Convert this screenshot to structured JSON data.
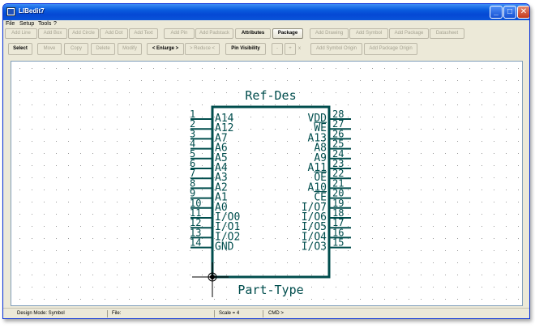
{
  "window": {
    "title": "LIBedit7",
    "minimize": "_",
    "maximize": "□",
    "close": "✕"
  },
  "menu": [
    "File",
    "Setup",
    "Tools",
    "?"
  ],
  "toolbar1": [
    {
      "label": "Add Line",
      "active": false
    },
    {
      "label": "Add Box",
      "active": false
    },
    {
      "label": "Add Circle",
      "active": false
    },
    {
      "label": "Add Dot",
      "active": false
    },
    {
      "label": "Add Text",
      "active": false
    },
    {
      "label": "Add Pin",
      "active": false
    },
    {
      "label": "Add Padstack",
      "active": false
    },
    {
      "label": "Attributes",
      "active": true
    },
    {
      "label": "Package",
      "active": true
    },
    {
      "label": "Add Drawing",
      "active": false
    },
    {
      "label": "Add Symbol",
      "active": false
    },
    {
      "label": "Add Package",
      "active": false
    },
    {
      "label": "Datasheet",
      "active": false
    }
  ],
  "toolbar2": [
    {
      "label": "Select",
      "active": true
    },
    {
      "label": "Move",
      "active": false
    },
    {
      "label": "Copy",
      "active": false
    },
    {
      "label": "Delete",
      "active": false
    },
    {
      "label": "Modify",
      "active": false
    },
    {
      "label": "< Enlarge >",
      "active": true
    },
    {
      "label": "> Reduce <",
      "active": false
    },
    {
      "label": "Pin Visibility",
      "active": true
    },
    {
      "label": "-",
      "active": false
    },
    {
      "label": "+",
      "active": false
    },
    {
      "label": "Add Symbol Origin",
      "active": false
    },
    {
      "label": "Add Package Origin",
      "active": false
    }
  ],
  "toolbar2_x_label": "x",
  "symbol": {
    "ref_des": "Ref-Des",
    "part_type": "Part-Type",
    "color": "#004d4d",
    "left_pins": [
      {
        "num": "1",
        "name": "A14"
      },
      {
        "num": "2",
        "name": "A12"
      },
      {
        "num": "3",
        "name": "A7"
      },
      {
        "num": "4",
        "name": "A6"
      },
      {
        "num": "5",
        "name": "A5"
      },
      {
        "num": "6",
        "name": "A4"
      },
      {
        "num": "7",
        "name": "A3"
      },
      {
        "num": "8",
        "name": "A2"
      },
      {
        "num": "9",
        "name": "A1"
      },
      {
        "num": "10",
        "name": "A0"
      },
      {
        "num": "11",
        "name": "I/O0"
      },
      {
        "num": "12",
        "name": "I/O1"
      },
      {
        "num": "13",
        "name": "I/O2"
      },
      {
        "num": "14",
        "name": "GND"
      }
    ],
    "right_pins": [
      {
        "num": "28",
        "name": "VDD"
      },
      {
        "num": "27",
        "name": "WE",
        "overbar": true
      },
      {
        "num": "26",
        "name": "A13"
      },
      {
        "num": "25",
        "name": "A8"
      },
      {
        "num": "24",
        "name": "A9"
      },
      {
        "num": "23",
        "name": "A11"
      },
      {
        "num": "22",
        "name": "OE",
        "overbar": true
      },
      {
        "num": "21",
        "name": "A10"
      },
      {
        "num": "20",
        "name": "CE",
        "overbar": true
      },
      {
        "num": "19",
        "name": "I/O7"
      },
      {
        "num": "18",
        "name": "I/O6"
      },
      {
        "num": "17",
        "name": "I/O5"
      },
      {
        "num": "16",
        "name": "I/O4"
      },
      {
        "num": "15",
        "name": "I/O3"
      }
    ]
  },
  "status": {
    "design_mode": "Design Mode: Symbol",
    "file": "File:",
    "scale": "Scale = 4",
    "cmd": "CMD >"
  }
}
